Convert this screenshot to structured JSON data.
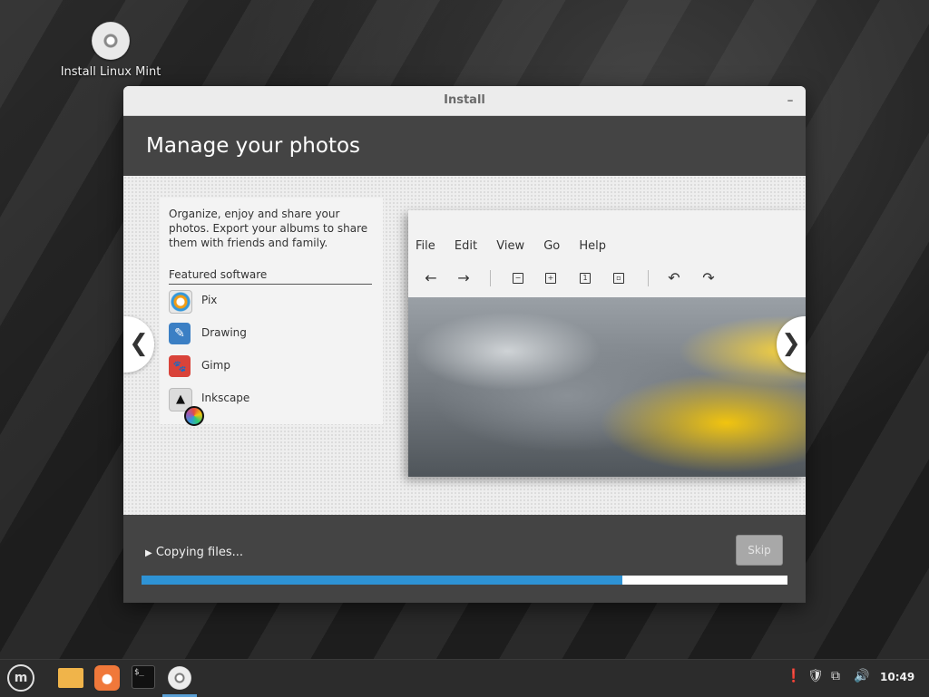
{
  "desktop": {
    "icon_label": "Install Linux Mint"
  },
  "window": {
    "title": "Install",
    "minimize_glyph": "–",
    "header_title": "Manage your photos",
    "description": "Organize, enjoy and share your photos. Export your albums to share them with friends and family.",
    "featured_heading": "Featured software",
    "apps": [
      {
        "name": "Pix",
        "color": "#e8e8e8"
      },
      {
        "name": "Drawing",
        "color": "#3b7fc4"
      },
      {
        "name": "Gimp",
        "color": "#d9433a"
      },
      {
        "name": "Inkscape",
        "color": "#dcdcdc"
      }
    ],
    "screenshot": {
      "menu": [
        "File",
        "Edit",
        "View",
        "Go",
        "Help"
      ],
      "toolbar_glyphs": {
        "back": "←",
        "forward": "→",
        "zoom_out": "−",
        "zoom_in": "+",
        "actual_size": "1",
        "fit": "▫",
        "rotate_left": "↶",
        "rotate_right": "↷"
      }
    },
    "nav": {
      "prev": "❮",
      "next": "❯"
    },
    "status_text": "Copying files...",
    "skip_label": "Skip",
    "progress": 0.745,
    "accent_color": "#2e93d5"
  },
  "taskbar": {
    "terminal_glyph": "$_",
    "clock": "10:49",
    "tray": {
      "updates": "❗",
      "shield": "🛡",
      "network": "⧉",
      "volume": "🔊"
    }
  }
}
